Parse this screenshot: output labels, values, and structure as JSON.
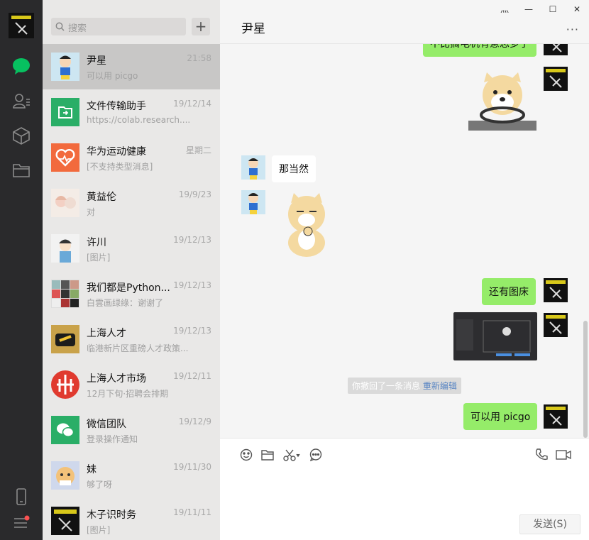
{
  "search": {
    "placeholder": "搜索",
    "add_label": "+"
  },
  "chats": [
    {
      "name": "尹星",
      "time": "21:58",
      "preview": "可以用 picgo",
      "active": true
    },
    {
      "name": "文件传输助手",
      "time": "19/12/14",
      "preview": "https://colab.research...."
    },
    {
      "name": "华为运动健康",
      "time": "星期二",
      "preview": "[不支持类型消息]"
    },
    {
      "name": "黄益伦",
      "time": "19/9/23",
      "preview": "对"
    },
    {
      "name": "许川",
      "time": "19/12/13",
      "preview": "[图片]"
    },
    {
      "name": "我们都是Python...",
      "time": "19/12/13",
      "preview": "白雲画绿綠：谢谢了"
    },
    {
      "name": "上海人才",
      "time": "19/12/13",
      "preview": "临港新片区重磅人才政策..."
    },
    {
      "name": "上海人才市场",
      "time": "19/12/11",
      "preview": "12月下旬·招聘会排期"
    },
    {
      "name": "微信团队",
      "time": "19/12/9",
      "preview": "登录操作通知"
    },
    {
      "name": "妹",
      "time": "19/11/30",
      "preview": "够了呀"
    },
    {
      "name": "木子识时务",
      "time": "19/11/11",
      "preview": "[图片]"
    }
  ],
  "conversation": {
    "title": "尹星",
    "window": {
      "pin": "⺣",
      "minimize": "—",
      "maximize": "☐",
      "close": "✕"
    },
    "more": "···",
    "messages": {
      "top_cut": "不比搞电机有意思多了",
      "reply1": "那当然",
      "mine1": "还有图床",
      "system": "你撤回了一条消息",
      "system_link": "重新编辑",
      "mine2": "可以用 picgo"
    },
    "send_label": "发送(S)"
  },
  "colors": {
    "accent": "#07c160",
    "bubble_green": "#95ec69",
    "rail": "#2a2a2c"
  }
}
